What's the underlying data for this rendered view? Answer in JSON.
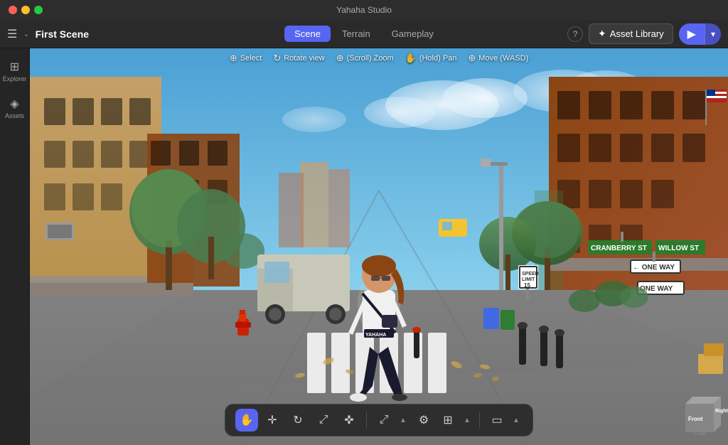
{
  "app": {
    "title": "Yahaha Studio",
    "window_title": "Yahaha Studio"
  },
  "title_bar": {
    "title": "Yahaha Studio",
    "close_label": "close",
    "minimize_label": "minimize",
    "maximize_label": "maximize"
  },
  "toolbar": {
    "scene_title": "First Scene",
    "hamburger_label": "☰",
    "chevron_label": "⌄",
    "tabs": [
      {
        "label": "Scene",
        "active": true
      },
      {
        "label": "Terrain",
        "active": false
      },
      {
        "label": "Gameplay",
        "active": false
      }
    ],
    "help_label": "?",
    "asset_library_icon": "✦",
    "asset_library_label": "Asset Library",
    "play_icon": "▶",
    "play_dropdown_icon": "▾"
  },
  "sidebar": {
    "items": [
      {
        "icon": "⊞",
        "label": "Explorer"
      },
      {
        "icon": "◈",
        "label": "Assets"
      }
    ]
  },
  "viewport": {
    "tools": [
      {
        "icon": "⊕",
        "label": "Select"
      },
      {
        "icon": "↻",
        "label": "Rotate view"
      },
      {
        "icon": "⊕",
        "label": "(Scroll) Zoom"
      },
      {
        "icon": "✋",
        "label": "(Hold) Pan"
      },
      {
        "icon": "⊕",
        "label": "Move (WASD)"
      }
    ]
  },
  "bottom_toolbar": {
    "tools": [
      {
        "icon": "✋",
        "active": true,
        "label": "hand-tool"
      },
      {
        "icon": "✛",
        "active": false,
        "label": "move-tool"
      },
      {
        "icon": "↻",
        "active": false,
        "label": "rotate-tool"
      },
      {
        "icon": "⤢",
        "active": false,
        "label": "scale-tool"
      },
      {
        "icon": "✜",
        "active": false,
        "label": "transform-tool"
      }
    ],
    "tools2": [
      {
        "icon": "⤢",
        "active": false,
        "label": "resize-tool"
      },
      {
        "icon": "⊞",
        "active": false,
        "label": "grid-tool"
      }
    ],
    "tools3": [
      {
        "icon": "▭",
        "active": false,
        "label": "camera-tool"
      }
    ]
  },
  "gizmo": {
    "front_label": "Front",
    "right_label": "Right"
  },
  "scene": {
    "street_sign_1": "CRANBERRY ST",
    "street_sign_2": "WILLOW ST",
    "one_way_label": "ONE WAY"
  }
}
